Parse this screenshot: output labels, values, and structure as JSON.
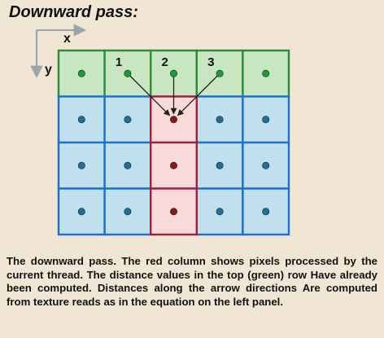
{
  "title": "Downward pass:",
  "axes": {
    "x_label": "x",
    "y_label": "y"
  },
  "grid": {
    "rows": 4,
    "cols": 5,
    "highlight_col": 2,
    "top_row_labels": [
      "1",
      "2",
      "3"
    ],
    "colors": {
      "green_fill": "#c8e6c2",
      "green_stroke": "#2e8b3a",
      "green_dot": "#1f9a3a",
      "blue_fill": "#bfe0ec",
      "blue_stroke": "#1f6fd1",
      "blue_dot": "#1f6f9a",
      "red_fill": "#f9dada",
      "red_stroke": "#a0203a",
      "red_dot": "#8a1a1a"
    }
  },
  "caption": {
    "lead": "The downward pass.",
    "text": " The red column shows pixels processed by the current thread. The distance values in the top (green) row Have already been computed. Distances along the arrow directions Are computed from texture reads as in the equation on the left panel."
  }
}
